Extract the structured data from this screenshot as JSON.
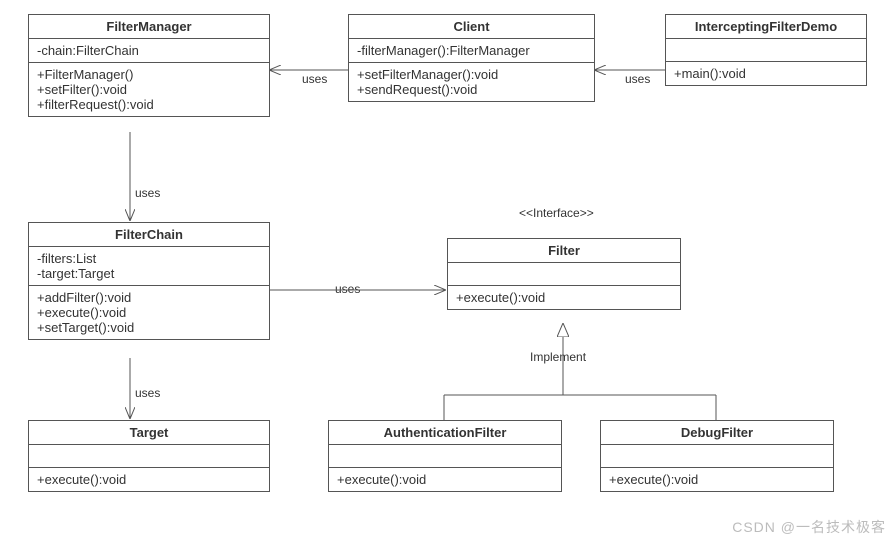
{
  "classes": {
    "filterManager": {
      "name": "FilterManager",
      "attrs": [
        "-chain:FilterChain"
      ],
      "ops": [
        "+FilterManager()",
        "+setFilter():void",
        "+filterRequest():void"
      ]
    },
    "client": {
      "name": "Client",
      "attrs": [
        "-filterManager():FilterManager"
      ],
      "ops": [
        "+setFilterManager():void",
        "+sendRequest():void"
      ]
    },
    "demo": {
      "name": "InterceptingFilterDemo",
      "attrs": [],
      "ops": [
        "+main():void"
      ]
    },
    "filterChain": {
      "name": "FilterChain",
      "attrs": [
        "-filters:List",
        "-target:Target"
      ],
      "ops": [
        "+addFilter():void",
        "+execute():void",
        "+setTarget():void"
      ]
    },
    "filter": {
      "stereotype": "<<Interface>>",
      "name": "Filter",
      "attrs": [],
      "ops": [
        "+execute():void"
      ]
    },
    "target": {
      "name": "Target",
      "attrs": [],
      "ops": [
        "+execute():void"
      ]
    },
    "authFilter": {
      "name": "AuthenticationFilter",
      "attrs": [],
      "ops": [
        "+execute():void"
      ]
    },
    "debugFilter": {
      "name": "DebugFilter",
      "attrs": [],
      "ops": [
        "+execute():void"
      ]
    }
  },
  "labels": {
    "uses1": "uses",
    "uses2": "uses",
    "uses3": "uses",
    "uses4": "uses",
    "uses5": "uses",
    "implement": "Implement"
  },
  "watermark": "CSDN @一名技术极客"
}
